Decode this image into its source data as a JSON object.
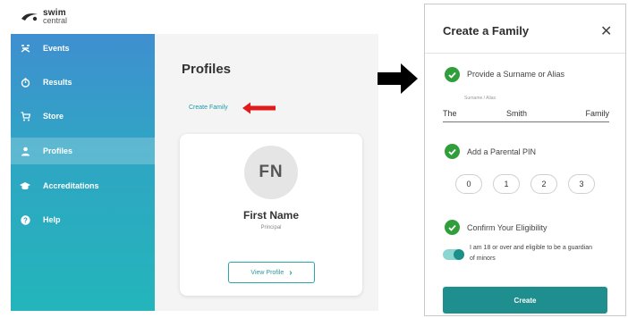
{
  "logo": {
    "line1": "swim",
    "line2": "central"
  },
  "sidebar": {
    "items": [
      {
        "label": "Events",
        "icon": "events-icon"
      },
      {
        "label": "Results",
        "icon": "stopwatch-icon"
      },
      {
        "label": "Store",
        "icon": "cart-icon"
      },
      {
        "label": "Profiles",
        "icon": "person-icon",
        "active": true
      },
      {
        "label": "Accreditations",
        "icon": "graduation-cap-icon"
      },
      {
        "label": "Help",
        "icon": "help-icon"
      }
    ]
  },
  "main": {
    "title": "Profiles",
    "create_family_link": "Create Family",
    "profile_card": {
      "initials": "FN",
      "name": "First Name",
      "role": "Principal",
      "view_button": "View Profile"
    }
  },
  "modal": {
    "title": "Create a Family",
    "close_symbol": "✕",
    "step1": {
      "label": "Provide a Surname or Alias",
      "field_label": "Surname / Alias",
      "value_parts": [
        "The",
        "Smith",
        "Family"
      ]
    },
    "step2": {
      "label": "Add a Parental PIN",
      "pin": [
        "0",
        "1",
        "2",
        "3"
      ]
    },
    "step3": {
      "label": "Confirm Your Eligibility",
      "toggle_on": true,
      "text": "I am 18 or over and eligible to be a guardian of minors"
    },
    "create_button": "Create"
  },
  "colors": {
    "sidebar_top": "#3f8fd0",
    "sidebar_bottom": "#23b5bb",
    "teal": "#1e8f8e",
    "check_green": "#2f9e3b",
    "arrow_red": "#e01b1b"
  }
}
